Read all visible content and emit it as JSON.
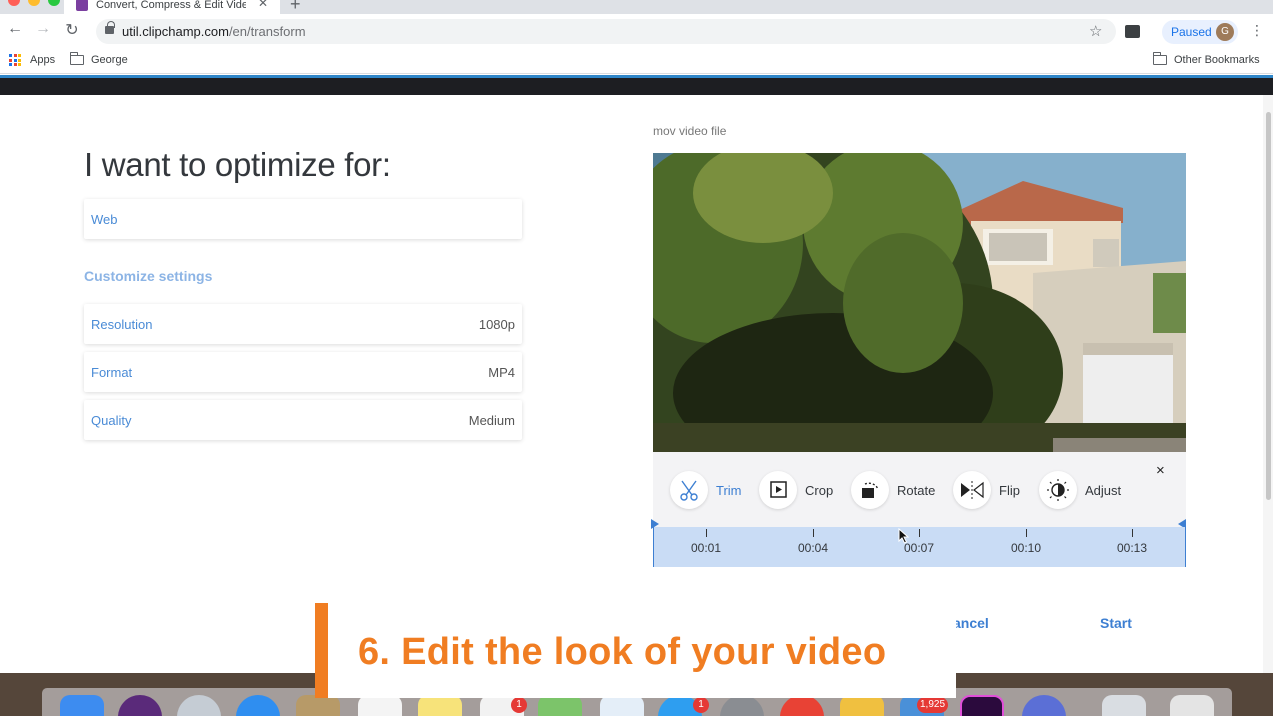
{
  "browser": {
    "tab_title": "Convert, Compress & Edit Video",
    "url_host": "util.clipchamp.com",
    "url_path": "/en/transform",
    "profile_status": "Paused",
    "profile_initial": "G",
    "bookmarks": {
      "apps_label": "Apps",
      "folder_label": "George",
      "other_label": "Other Bookmarks"
    }
  },
  "page": {
    "title": "I want to optimize for:",
    "optimize_value": "Web",
    "customize_heading": "Customize settings",
    "settings": [
      {
        "label": "Resolution",
        "value": "1080p"
      },
      {
        "label": "Format",
        "value": "MP4"
      },
      {
        "label": "Quality",
        "value": "Medium"
      }
    ],
    "file_label": "mov video file",
    "tools": [
      {
        "label": "Trim",
        "icon": "scissors-icon",
        "active": true
      },
      {
        "label": "Crop",
        "icon": "crop-icon",
        "active": false
      },
      {
        "label": "Rotate",
        "icon": "rotate-icon",
        "active": false
      },
      {
        "label": "Flip",
        "icon": "flip-icon",
        "active": false
      },
      {
        "label": "Adjust",
        "icon": "adjust-icon",
        "active": false
      }
    ],
    "close_symbol": "×",
    "timeline_labels": [
      "00:01",
      "00:04",
      "00:07",
      "00:10",
      "00:13"
    ],
    "cancel_label": "ancel",
    "start_label": "Start"
  },
  "overlay": {
    "caption": "6. Edit the look of your video",
    "accent_color": "#f07d22"
  },
  "dock": {
    "badges": [
      "1",
      "1",
      "1,925"
    ]
  },
  "colors": {
    "link_blue": "#3d7fd2",
    "header_dark": "#1d1e22"
  }
}
